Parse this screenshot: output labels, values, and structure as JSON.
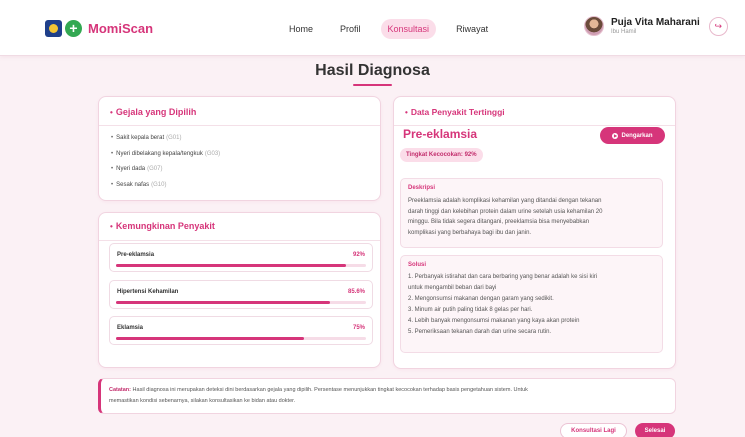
{
  "app": {
    "name": "MomiScan",
    "colors": {
      "accent": "#d6357a",
      "accent_light": "#fbdde9",
      "background": "#fbf1f5"
    }
  },
  "nav": {
    "items": [
      {
        "label": "Home",
        "active": false
      },
      {
        "label": "Profil",
        "active": false
      },
      {
        "label": "Konsultasi",
        "active": true
      },
      {
        "label": "Riwayat",
        "active": false
      }
    ]
  },
  "user": {
    "name": "Puja Vita Maharani",
    "role": "Ibu Hamil"
  },
  "icons": {
    "logout": "logout-icon",
    "listen": "speaker-icon"
  },
  "page": {
    "title": "Hasil Diagnosa"
  },
  "symptoms": {
    "heading": "Gejala yang Dipilih",
    "items": [
      {
        "text": "Sakit kepala berat",
        "code": "(G01)"
      },
      {
        "text": "Nyeri dibelakang kepala/tengkuk",
        "code": "(G03)"
      },
      {
        "text": "Nyeri dada",
        "code": "(G07)"
      },
      {
        "text": "Sesak nafas",
        "code": "(G10)"
      }
    ]
  },
  "possibilities": {
    "heading": "Kemungkinan Penyakit",
    "items": [
      {
        "name": "Pre-eklamsia",
        "percent_label": "92%",
        "value": 92
      },
      {
        "name": "Hipertensi Kehamilan",
        "percent_label": "85.6%",
        "value": 85.6
      },
      {
        "name": "Eklamsia",
        "percent_label": "75%",
        "value": 75
      }
    ]
  },
  "top_disease": {
    "heading": "Data Penyakit Tertinggi",
    "name": "Pre-eklamsia",
    "listen_label": "Dengarkan",
    "match_label": "Tingkat Kecocokan: 92%",
    "description_title": "Deskripsi",
    "description_lines": [
      "Preeklamsia adalah komplikasi kehamilan yang ditandai dengan tekanan",
      "darah tinggi dan kelebihan protein dalam urine setelah usia kehamilan 20",
      "minggu. Bila tidak segera ditangani, preeklamsia bisa menyebabkan",
      "komplikasi yang berbahaya bagi ibu dan janin."
    ],
    "solution_title": "Solusi",
    "solutions": [
      "1. Perbanyak istirahat dan cara berbaring yang benar adalah ke sisi kiri",
      "untuk mengambil beban dari bayi",
      "2. Mengonsumsi makanan dengan garam yang sedikit.",
      "3. Minum air putih paling tidak 8 gelas per hari.",
      "4. Lebih banyak mengonsumsi makanan yang kaya akan protein",
      "5. Pemeriksaan tekanan darah dan urine secara rutin."
    ]
  },
  "note": {
    "label": "Catatan:",
    "line1": "Hasil diagnosa ini merupakan deteksi dini berdasarkan gejala yang dipilih. Persentase menunjukkan tingkat kecocokan terhadap basis pengetahuan sistem. Untuk",
    "line2": "memastikan kondisi sebenarnya, silakan konsultasikan ke bidan atau dokter."
  },
  "actions": {
    "again_label": "Konsultasi Lagi",
    "done_label": "Selesai"
  }
}
